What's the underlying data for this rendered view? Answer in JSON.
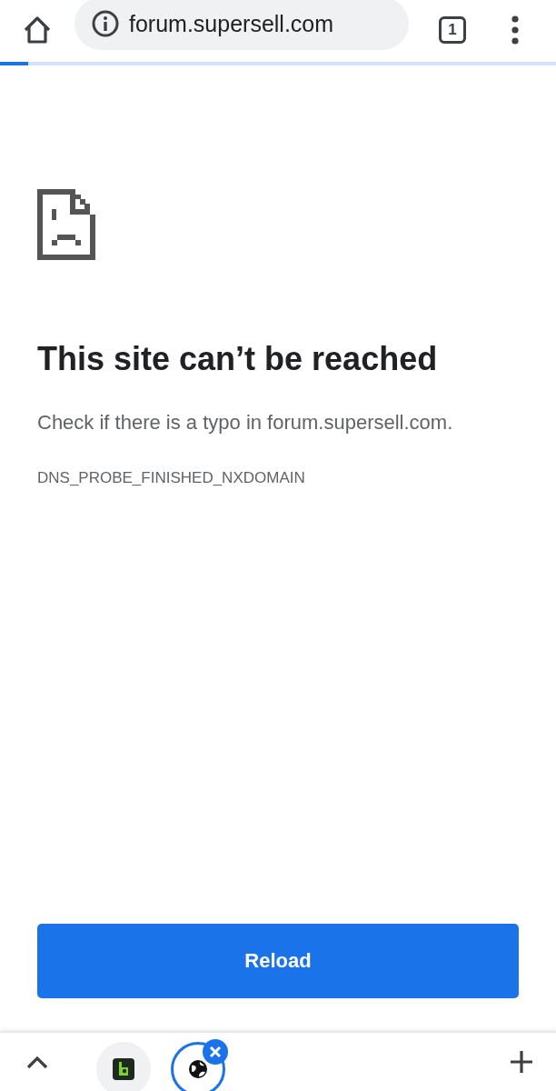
{
  "toolbar": {
    "url": "forum.supersell.com",
    "tab_count": "1"
  },
  "progress": {
    "level": 0.05
  },
  "error": {
    "title": "This site can’t be reached",
    "message": "Check if there is a typo in forum.supersell.com.",
    "code": "DNS_PROBE_FINISHED_NXDOMAIN"
  },
  "reload_button": "Reload",
  "tab_strip": {
    "tabs": [
      {
        "selected": false
      },
      {
        "selected": true
      }
    ]
  }
}
